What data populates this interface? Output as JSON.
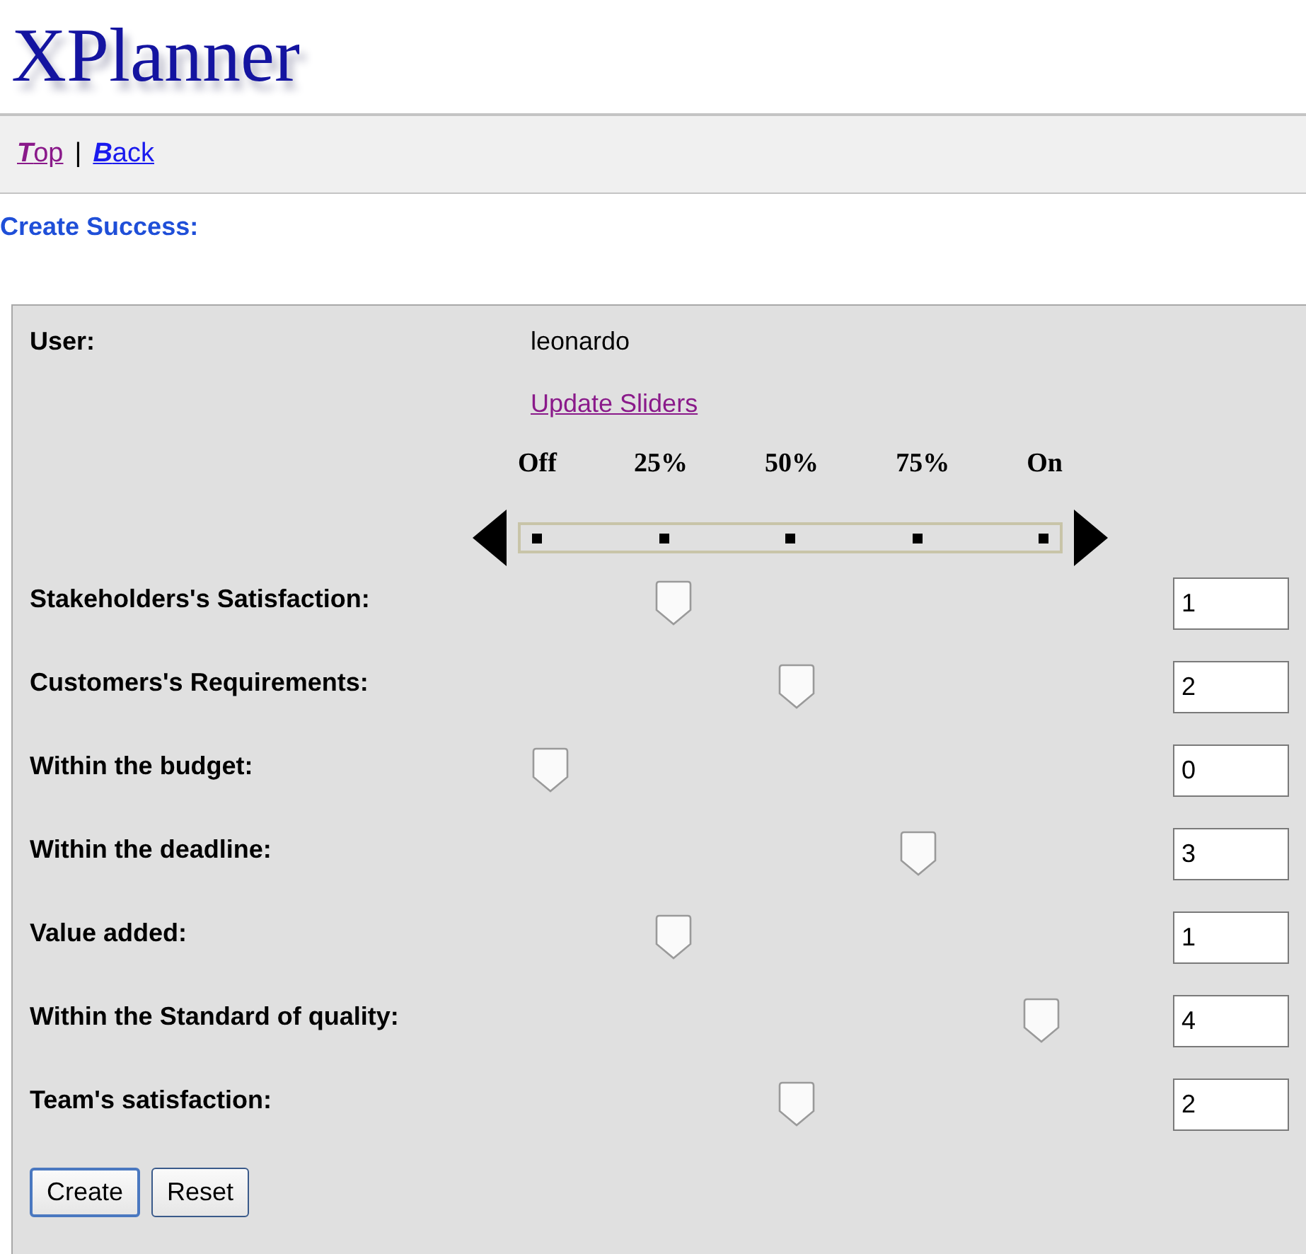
{
  "header": {
    "title": "XPlanner"
  },
  "nav": {
    "links": [
      {
        "label": "**T**op",
        "visited": true
      },
      {
        "label": "**B**ack",
        "visited": false
      }
    ],
    "separator": "|"
  },
  "message": "Create Success:",
  "form": {
    "user_label": "User:",
    "user_value": "leonardo",
    "update_link": {
      "label": "Update Sliders",
      "visited": true
    },
    "scale": [
      "Off",
      "25%",
      "50%",
      "75%",
      "On"
    ],
    "rows": [
      {
        "label": "Stakeholders's Satisfaction:",
        "level": 0.25,
        "value": "1"
      },
      {
        "label": "Customers's Requirements:",
        "level": 0.5,
        "value": "2"
      },
      {
        "label": "Within the budget:",
        "level": 0,
        "value": "0"
      },
      {
        "label": "Within the deadline:",
        "level": 0.75,
        "value": "3"
      },
      {
        "label": "Value added:",
        "level": 0.25,
        "value": "1"
      },
      {
        "label": "Within the Standard of quality:",
        "level": 1,
        "value": "4"
      },
      {
        "label": "Team's satisfaction:",
        "level": 0.5,
        "value": "2"
      }
    ],
    "buttons": [
      {
        "label": "Create",
        "focused": true
      },
      {
        "label": "Reset",
        "focused": false
      }
    ]
  }
}
